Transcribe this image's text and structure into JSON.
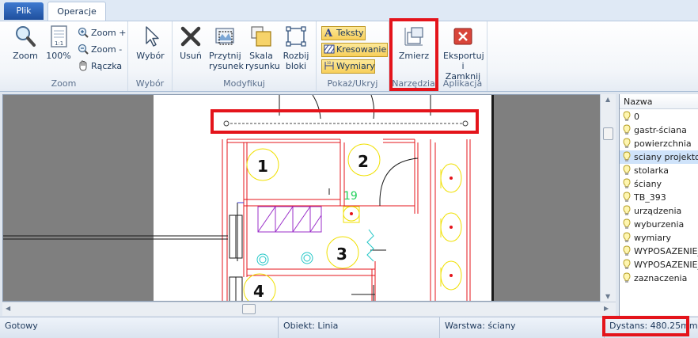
{
  "tabs": {
    "file": "Plik",
    "operations": "Operacje"
  },
  "ribbon": {
    "zoom_group": {
      "label": "Zoom",
      "zoom": "Zoom",
      "percent": "100%",
      "zoom_in": "Zoom +",
      "zoom_out": "Zoom -",
      "hand": "Rączka"
    },
    "select_group": {
      "label": "Wybór",
      "select": "Wybór"
    },
    "modify_group": {
      "label": "Modyfikuj",
      "delete": "Usuń",
      "crop": "Przytnij\nrysunek",
      "scale": "Skala\nrysunku",
      "explode": "Rozbij\nbloki"
    },
    "show_group": {
      "label": "Pokaż/Ukryj",
      "texts": "Teksty",
      "hatching": "Kresowanie",
      "dimensions": "Wymiary"
    },
    "tools_group": {
      "label": "Narzędzia",
      "measure": "Zmierz"
    },
    "app_group": {
      "label": "Aplikacja",
      "export_close": "Eksportuj\ni Zamknij"
    }
  },
  "drawing": {
    "room_labels": [
      "1",
      "2",
      "3",
      "4"
    ],
    "green_text": "19"
  },
  "layers": {
    "header": "Nazwa",
    "items": [
      {
        "name": "0",
        "selected": false
      },
      {
        "name": "gastr-ściana",
        "selected": false
      },
      {
        "name": "powierzchnia",
        "selected": false
      },
      {
        "name": "sciany projektow",
        "selected": true
      },
      {
        "name": "stolarka",
        "selected": false
      },
      {
        "name": "ściany",
        "selected": false
      },
      {
        "name": "TB_393",
        "selected": false
      },
      {
        "name": "urządzenia",
        "selected": false
      },
      {
        "name": "wyburzenia",
        "selected": false
      },
      {
        "name": "wymiary",
        "selected": false
      },
      {
        "name": "WYPOSAZENIE_",
        "selected": false
      },
      {
        "name": "WYPOSAZENIE_",
        "selected": false
      },
      {
        "name": "zaznaczenia",
        "selected": false
      }
    ]
  },
  "status": {
    "ready": "Gotowy",
    "object": "Obiekt: Linia",
    "layer": "Warstwa: ściany",
    "distance": "Dystans: 480.25mm"
  },
  "colors": {
    "highlight": "#e4141b",
    "wall": "#e4141b",
    "fixture": "#f0e000",
    "hatch": "#9b2fc9",
    "cyan": "#21c6c6"
  }
}
